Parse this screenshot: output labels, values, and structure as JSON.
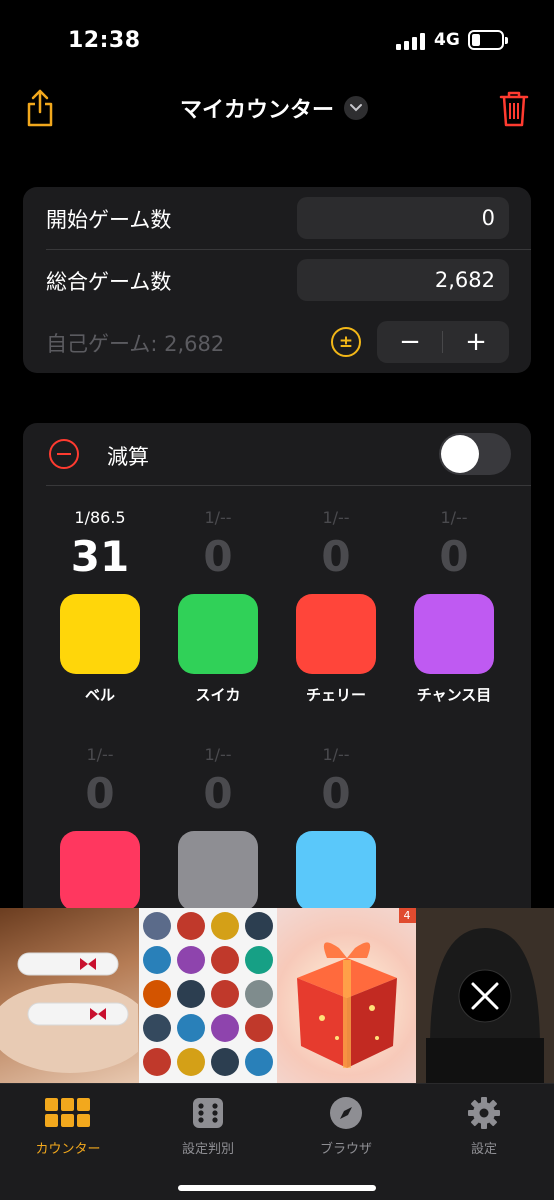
{
  "status_bar": {
    "time": "12:38",
    "network": "4G"
  },
  "nav": {
    "title": "マイカウンター",
    "share_icon": "share-icon",
    "trash_icon": "trash-icon"
  },
  "games": {
    "start_label": "開始ゲーム数",
    "start_value": "0",
    "total_label": "総合ゲーム数",
    "total_value": "2,682",
    "self_label": "自己ゲーム: 2,682",
    "pm_symbol": "±",
    "minus": "−",
    "plus": "+"
  },
  "subtract": {
    "label": "減算",
    "toggle_on": false
  },
  "counters": [
    {
      "name": "ベル",
      "prob": "1/86.5",
      "count": "31",
      "color": "#ffd60a"
    },
    {
      "name": "スイカ",
      "prob": "1/--",
      "count": "0",
      "color": "#30d158"
    },
    {
      "name": "チェリー",
      "prob": "1/--",
      "count": "0",
      "color": "#ff453a"
    },
    {
      "name": "チャンス目",
      "prob": "1/--",
      "count": "0",
      "color": "#bf5af2"
    },
    {
      "name": "",
      "prob": "1/--",
      "count": "0",
      "color": "#ff375f"
    },
    {
      "name": "",
      "prob": "1/--",
      "count": "0",
      "color": "#8e8e93"
    },
    {
      "name": "",
      "prob": "1/--",
      "count": "0",
      "color": "#5ac8fa"
    }
  ],
  "ad": {
    "badge": "4"
  },
  "tabs": [
    {
      "label": "カウンター",
      "icon": "grid-icon",
      "active": true
    },
    {
      "label": "設定判別",
      "icon": "dice-icon",
      "active": false
    },
    {
      "label": "ブラウザ",
      "icon": "compass-icon",
      "active": false
    },
    {
      "label": "設定",
      "icon": "gear-icon",
      "active": false
    }
  ],
  "colors": {
    "accent": "#f2a81d",
    "destructive": "#ff3b30",
    "card": "#1c1c1e"
  }
}
